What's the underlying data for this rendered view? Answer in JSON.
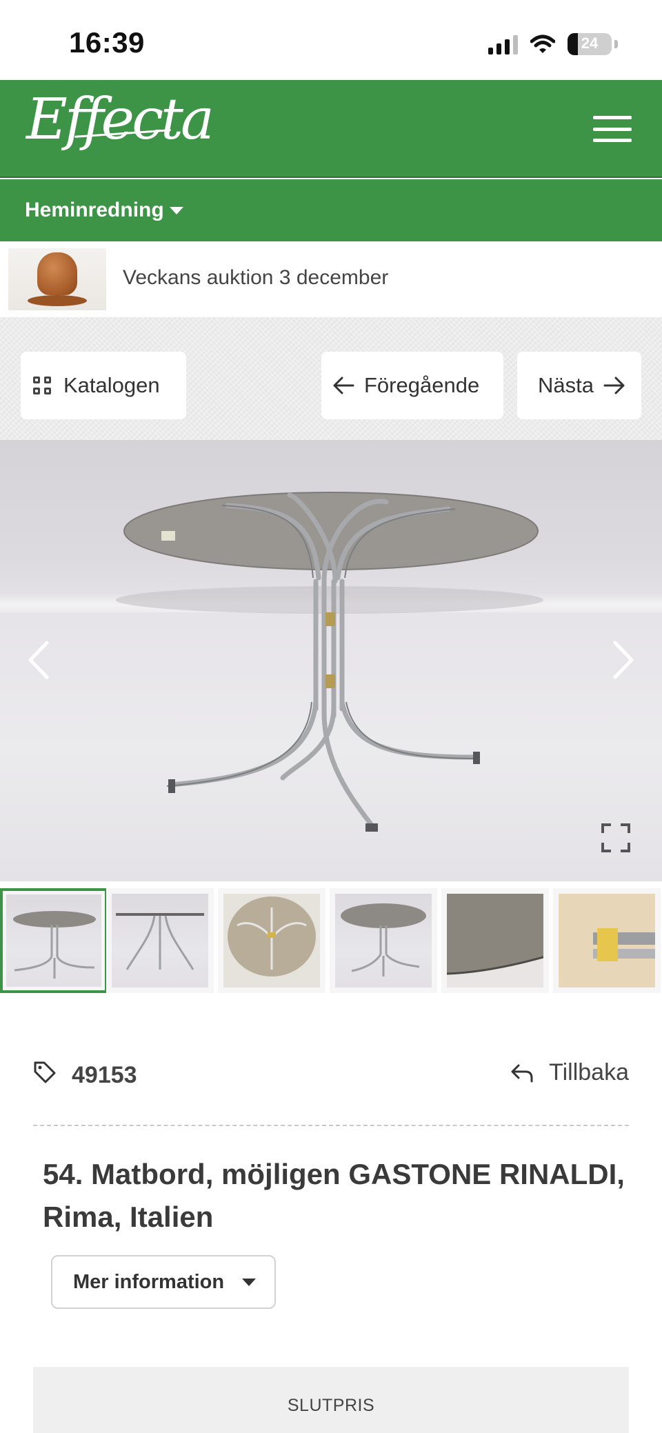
{
  "status_bar": {
    "time": "16:39",
    "battery": "24",
    "battery_level": 0.24
  },
  "header": {
    "logo": "Effecta",
    "menu_icon": "hamburger-icon"
  },
  "category": {
    "label": "Heminredning"
  },
  "auction": {
    "title": "Veckans auktion 3 december"
  },
  "nav": {
    "catalog": "Katalogen",
    "previous": "Föregående",
    "next": "Nästa"
  },
  "gallery": {
    "thumbnail_count": 6,
    "active_index": 0
  },
  "lot": {
    "number": "49153",
    "back": "Tillbaka",
    "title": "54. Matbord, möjligen GASTONE RINALDI, Rima, Italien",
    "more_info": "Mer information"
  },
  "price": {
    "label": "SLUTPRIS"
  },
  "colors": {
    "brand_green": "#3d9447",
    "text_dark": "#3a3a3a"
  }
}
